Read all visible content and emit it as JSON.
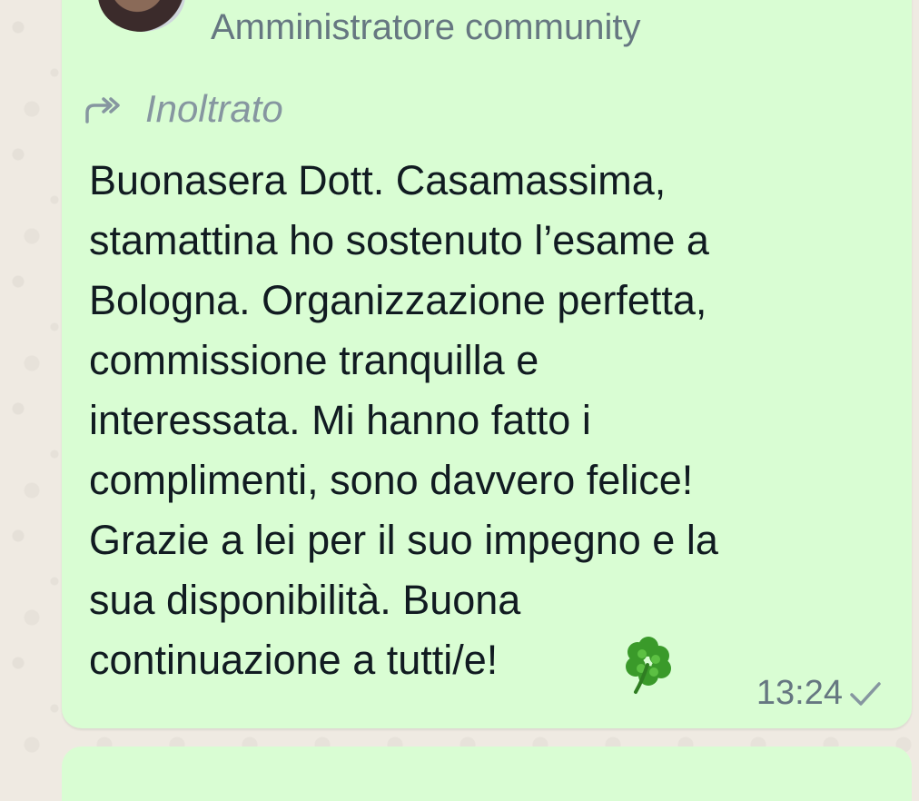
{
  "message": {
    "sender_role": "Amministratore community",
    "forwarded_label": "Inoltrato",
    "text": "Buonasera Dott. Casamassima,\nstamattina ho sostenuto l’esame a\nBologna. Organizzazione perfetta,\ncommissione tranquilla e\ninteressata. Mi hanno fatto i\ncomplimenti, sono davvero felice!\nGrazie a lei per il suo impegno e la\nsua disponibilità. Buona\ncontinuazione a tutti/e!",
    "emoji": "four-leaf-clover-icon",
    "time": "13:24",
    "status_icon": "single-check-icon"
  },
  "colors": {
    "bubble": "#d9fdd3",
    "wallpaper": "#efeae2",
    "text": "#111b21",
    "meta": "#667781"
  }
}
